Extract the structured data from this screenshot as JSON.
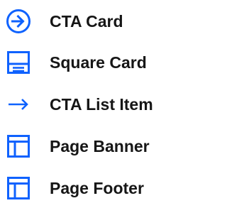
{
  "colors": {
    "icon": "#0f62fe",
    "text": "#161616",
    "background": "#ffffff"
  },
  "items": [
    {
      "icon": "arrow-right-circle-icon",
      "label": "CTA Card"
    },
    {
      "icon": "square-card-icon",
      "label": "Square Card"
    },
    {
      "icon": "arrow-right-icon",
      "label": "CTA List Item"
    },
    {
      "icon": "page-banner-icon",
      "label": "Page Banner"
    },
    {
      "icon": "page-footer-icon",
      "label": "Page Footer"
    }
  ]
}
